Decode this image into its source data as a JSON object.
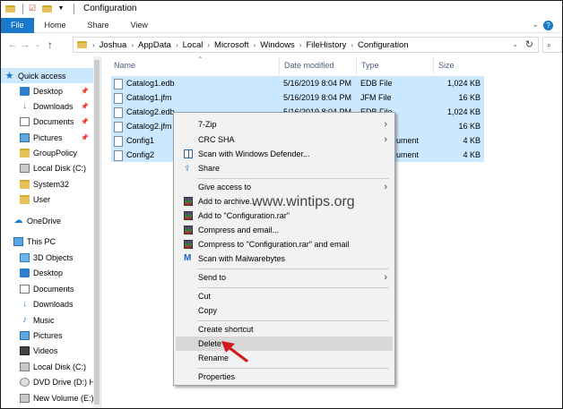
{
  "window": {
    "title": "Configuration"
  },
  "ribbon": {
    "tabs": [
      "File",
      "Home",
      "Share",
      "View"
    ]
  },
  "address": {
    "breadcrumbs": [
      "Joshua",
      "AppData",
      "Local",
      "Microsoft",
      "Windows",
      "FileHistory",
      "Configuration"
    ]
  },
  "nav": {
    "items": [
      {
        "label": "Quick access",
        "icon": "star-icon",
        "pinned": false
      },
      {
        "label": "Desktop",
        "icon": "desktop-icon",
        "pinned": true
      },
      {
        "label": "Downloads",
        "icon": "downloads-icon",
        "pinned": true
      },
      {
        "label": "Documents",
        "icon": "documents-icon",
        "pinned": true
      },
      {
        "label": "Pictures",
        "icon": "pictures-icon",
        "pinned": true
      },
      {
        "label": "GroupPolicy",
        "icon": "folder-icon",
        "pinned": false
      },
      {
        "label": "Local Disk (C:)",
        "icon": "drive-icon",
        "pinned": false
      },
      {
        "label": "System32",
        "icon": "folder-icon",
        "pinned": false
      },
      {
        "label": "User",
        "icon": "folder-icon",
        "pinned": false
      },
      {
        "label": "OneDrive",
        "icon": "cloud-icon",
        "pinned": false
      },
      {
        "label": "This PC",
        "icon": "pc-icon",
        "pinned": false
      },
      {
        "label": "3D Objects",
        "icon": "3d-objects-icon",
        "pinned": false
      },
      {
        "label": "Desktop",
        "icon": "desktop-icon",
        "pinned": false
      },
      {
        "label": "Documents",
        "icon": "documents-icon",
        "pinned": false
      },
      {
        "label": "Downloads",
        "icon": "downloads-icon",
        "pinned": false
      },
      {
        "label": "Music",
        "icon": "music-icon",
        "pinned": false
      },
      {
        "label": "Pictures",
        "icon": "pictures-icon",
        "pinned": false
      },
      {
        "label": "Videos",
        "icon": "videos-icon",
        "pinned": false
      },
      {
        "label": "Local Disk (C:)",
        "icon": "drive-icon",
        "pinned": false
      },
      {
        "label": "DVD Drive (D:) H",
        "icon": "dvd-icon",
        "pinned": false
      },
      {
        "label": "New Volume (E:)",
        "icon": "drive-icon",
        "pinned": false
      }
    ]
  },
  "files": {
    "columns": [
      "Name",
      "Date modified",
      "Type",
      "Size"
    ],
    "rows": [
      {
        "name": "Catalog1.edb",
        "date": "5/16/2019 8:04 PM",
        "type": "EDB File",
        "size": "1,024 KB"
      },
      {
        "name": "Catalog1.jfm",
        "date": "5/16/2019 8:04 PM",
        "type": "JFM File",
        "size": "16 KB"
      },
      {
        "name": "Catalog2.edb",
        "date": "5/16/2019 8:04 PM",
        "type": "EDB File",
        "size": "1,024 KB"
      },
      {
        "name": "Catalog2.jfm",
        "date": "",
        "type": "",
        "size": "16 KB"
      },
      {
        "name": "Config1",
        "date": "",
        "type": "ument",
        "size": "4 KB"
      },
      {
        "name": "Config2",
        "date": "",
        "type": "ument",
        "size": "4 KB"
      }
    ]
  },
  "context_menu": {
    "items": [
      "7-Zip",
      "CRC SHA",
      "Scan with Windows Defender...",
      "Share",
      "Give access to",
      "Add to archive...",
      "Add to \"Configuration.rar\"",
      "Compress and email...",
      "Compress to \"Configuration.rar\" and email",
      "Scan with Malwarebytes",
      "Send to",
      "Cut",
      "Copy",
      "Create shortcut",
      "Delete",
      "Rename",
      "Properties"
    ],
    "highlighted": "Delete"
  },
  "watermark": "www.wintips.org",
  "colors": {
    "accent": "#1979ca",
    "selection": "#cce8ff",
    "pointer": "#d21a1a"
  }
}
